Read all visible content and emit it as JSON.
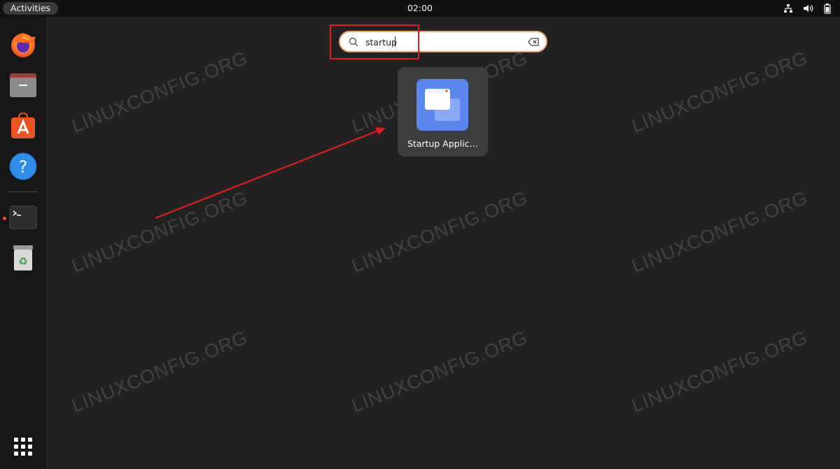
{
  "topbar": {
    "activities_label": "Activities",
    "clock": "02:00",
    "tray_icons": [
      "network-icon",
      "volume-icon",
      "battery-icon"
    ]
  },
  "dock": {
    "items": [
      {
        "name": "firefox",
        "icon": "firefox-icon"
      },
      {
        "name": "files",
        "icon": "files-icon"
      },
      {
        "name": "software",
        "icon": "software-store-icon"
      },
      {
        "name": "help",
        "icon": "help-icon"
      },
      {
        "name": "terminal",
        "icon": "terminal-icon",
        "running": true
      },
      {
        "name": "trash",
        "icon": "trash-icon"
      }
    ],
    "show_apps_icon": "app-grid-icon"
  },
  "search": {
    "value": "startup",
    "icon": "search-icon",
    "clear_icon": "clear-text-icon"
  },
  "results": [
    {
      "label": "Startup Applic…",
      "icon": "startup-applications-icon"
    }
  ],
  "watermark": "LINUXCONFIG.ORG",
  "colors": {
    "accent": "#e95420",
    "annotation": "#e31b1b",
    "search_focus": "#e9a071",
    "app_icon_blue": "#5b85f0"
  }
}
